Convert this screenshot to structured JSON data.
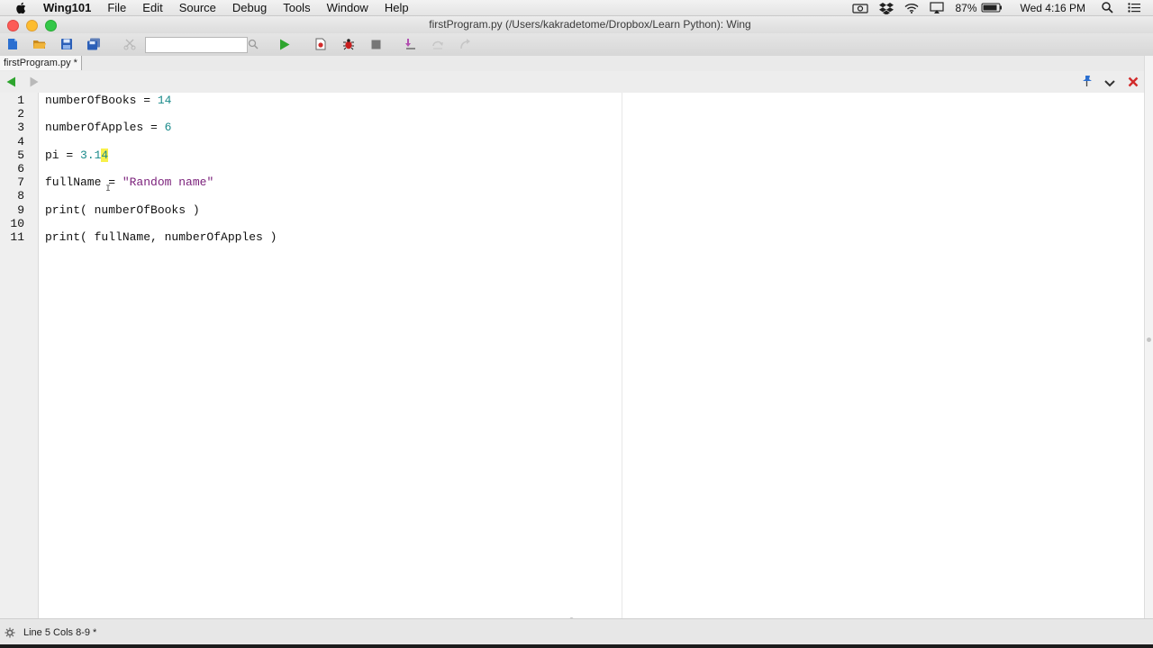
{
  "menubar": {
    "app": "Wing101",
    "items": [
      "File",
      "Edit",
      "Source",
      "Debug",
      "Tools",
      "Window",
      "Help"
    ],
    "battery": "87%",
    "clock": "Wed 4:16 PM"
  },
  "window": {
    "title": "firstProgram.py (/Users/kakradetome/Dropbox/Learn Python): Wing"
  },
  "toolbar": {
    "search_value": ""
  },
  "editor": {
    "tab_label": "firstProgram.py *",
    "lines": [
      {
        "n": "1",
        "parts": [
          {
            "t": "numberOfBooks = ",
            "c": "#111111"
          },
          {
            "t": "14",
            "c": "#1a8a8a"
          }
        ]
      },
      {
        "n": "2",
        "parts": []
      },
      {
        "n": "3",
        "parts": [
          {
            "t": "numberOfApples = ",
            "c": "#111111"
          },
          {
            "t": "6",
            "c": "#1a8a8a"
          }
        ]
      },
      {
        "n": "4",
        "parts": []
      },
      {
        "n": "5",
        "parts": [
          {
            "t": "pi = ",
            "c": "#111111"
          },
          {
            "t": "3.1",
            "c": "#1a8a8a"
          },
          {
            "t": "4",
            "c": "#1a8a8a",
            "hl": true
          }
        ]
      },
      {
        "n": "6",
        "parts": []
      },
      {
        "n": "7",
        "parts": [
          {
            "t": "fullName = ",
            "c": "#111111"
          },
          {
            "t": "\"Random name\"",
            "c": "#7a1f7a"
          }
        ]
      },
      {
        "n": "8",
        "parts": []
      },
      {
        "n": "9",
        "parts": [
          {
            "t": "print( numberOfBooks )",
            "c": "#111111"
          }
        ]
      },
      {
        "n": "10",
        "parts": []
      },
      {
        "n": "11",
        "parts": [
          {
            "t": "print( fullName, numberOfApples )",
            "c": "#111111"
          }
        ]
      }
    ]
  },
  "status": {
    "text": "Line 5 Cols 8-9 *"
  },
  "colors": {
    "number": "#1a8a8a",
    "string": "#7a1f7a",
    "highlight": "#f8f04a",
    "run_green": "#2ea52e",
    "close_red": "#d22b2b"
  }
}
